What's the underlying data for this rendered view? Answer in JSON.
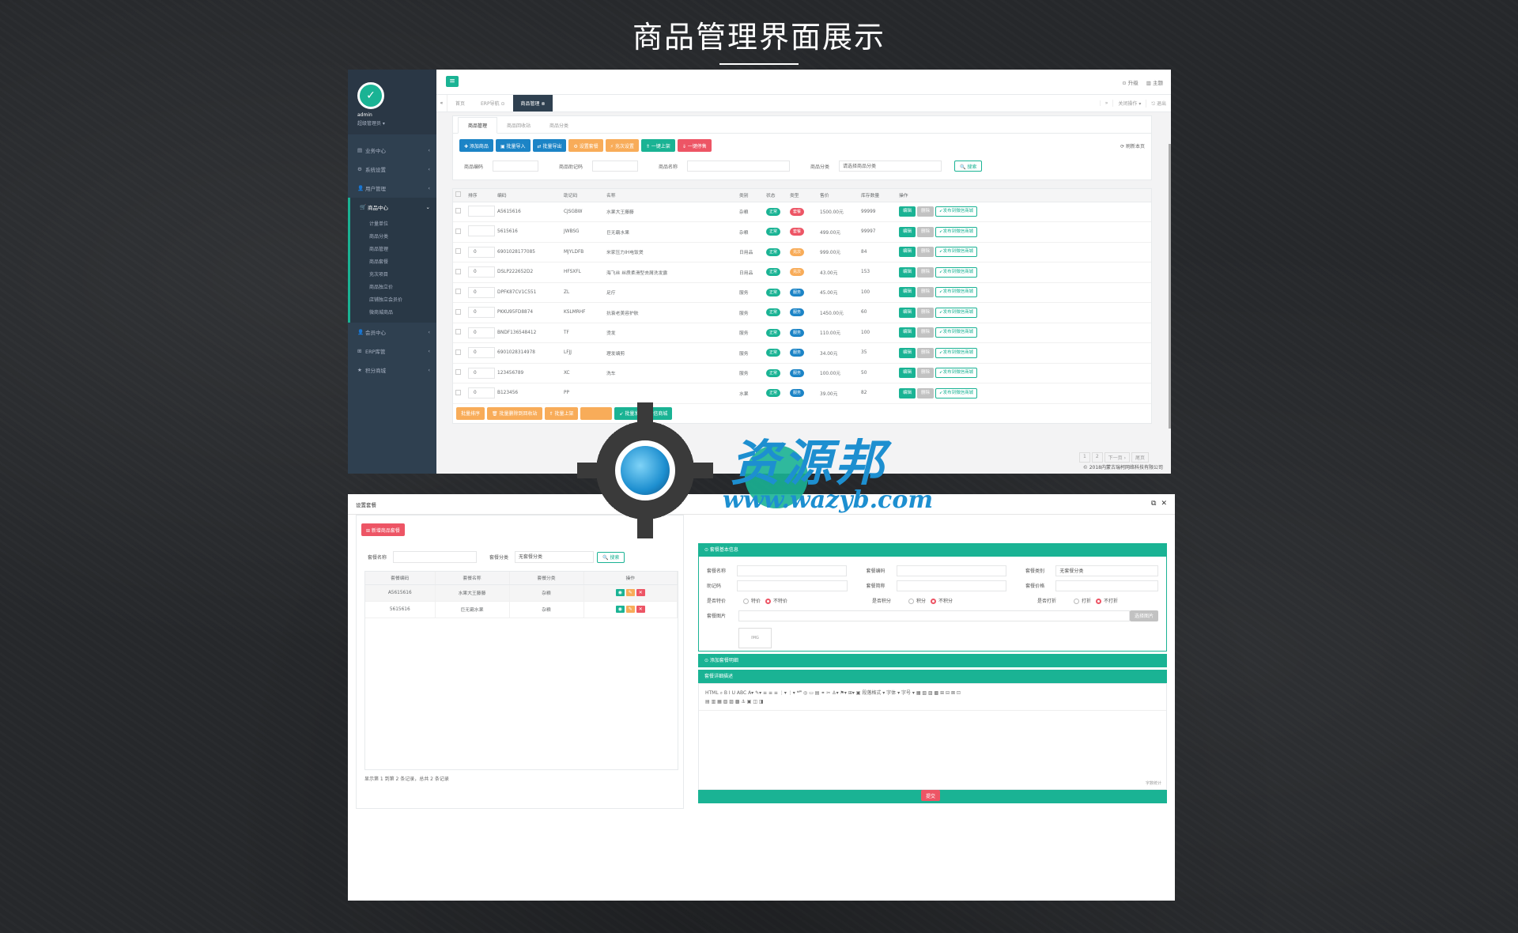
{
  "page": {
    "title": "商品管理界面展示"
  },
  "sidebar": {
    "user": "admin",
    "role": "超级管理员 ▾",
    "items": [
      {
        "icon": "chart-icon",
        "label": "业务中心"
      },
      {
        "icon": "gear-icon",
        "label": "系统设置"
      },
      {
        "icon": "user-icon",
        "label": "用户管理"
      }
    ],
    "active": "商品中心",
    "sub": [
      "计量单位",
      "商品分类",
      "商品管理",
      "商品套餐",
      "充次项目",
      "商品独立价",
      "店铺独立会员价",
      "微商城商品"
    ],
    "after": [
      {
        "icon": "user-icon",
        "label": "会员中心"
      },
      {
        "icon": "sitemap-icon",
        "label": "ERP库管"
      },
      {
        "icon": "star-icon",
        "label": "积分商城"
      }
    ]
  },
  "header": {
    "upgrade": "⊙ 升级",
    "theme": "▥ 主题"
  },
  "tabs": {
    "home": "首页",
    "erp": "ERP导航 ⊙",
    "goods": "商品管理 ⊗",
    "close_ops": "关闭操作 ▾",
    "logout": "⎋ 退出"
  },
  "panel": {
    "tabs": [
      "商品管理",
      "商品回收站",
      "商品分类"
    ],
    "buttons": [
      "✚ 添加商品",
      "▣ 批量导入",
      "⇄ 批量导出",
      "⚙ 设置套餐",
      "⚡ 充次设置",
      "⇑ 一键上架",
      "⇓ 一键停售"
    ],
    "refresh": "⟳ 刷新本页",
    "filters": {
      "code": "商品编码",
      "mnemonic": "商品助记码",
      "name": "商品名称",
      "category": "商品分类",
      "category_ph": "请选择商品分类",
      "search": "🔍 搜索"
    }
  },
  "table": {
    "headers": [
      "",
      "排序",
      "编码",
      "助记码",
      "名称",
      "类别",
      "状态",
      "类型",
      "售价",
      "库存数量",
      "操作"
    ],
    "rows": [
      {
        "sort": "",
        "code": "A5615616",
        "mn": "CJSGBW",
        "name": "水果大王藤藤",
        "cat": "杂粮",
        "status": "正常",
        "type": "套餐",
        "tc": "r",
        "price": "1500.00元",
        "stock": "99999"
      },
      {
        "sort": "",
        "code": "5615616",
        "mn": "JWBSG",
        "name": "巨无霸水果",
        "cat": "杂粮",
        "status": "正常",
        "type": "套餐",
        "tc": "r",
        "price": "499.00元",
        "stock": "99997"
      },
      {
        "sort": "0",
        "code": "6901028177085",
        "mn": "MJYLDFB",
        "name": "米家压力IH电饭煲",
        "cat": "日用品",
        "status": "正常",
        "type": "充次",
        "tc": "o",
        "price": "999.00元",
        "stock": "84"
      },
      {
        "sort": "0",
        "code": "DSLP222652D2",
        "mn": "HFSXFL",
        "name": "海飞丝 丝质柔滑型去屑洗发露",
        "cat": "日用品",
        "status": "正常",
        "type": "充次",
        "tc": "o",
        "price": "43.00元",
        "stock": "153"
      },
      {
        "sort": "0",
        "code": "DPFK87CV1C551",
        "mn": "ZL",
        "name": "足疗",
        "cat": "服务",
        "status": "正常",
        "type": "服务",
        "tc": "b",
        "price": "45.00元",
        "stock": "100"
      },
      {
        "sort": "0",
        "code": "PKKU95FD8874",
        "mn": "KSLMRHF",
        "name": "抗衰老美容护肤",
        "cat": "服务",
        "status": "正常",
        "type": "服务",
        "tc": "b",
        "price": "1450.00元",
        "stock": "60"
      },
      {
        "sort": "0",
        "code": "BNDF136548412",
        "mn": "TF",
        "name": "烫发",
        "cat": "服务",
        "status": "正常",
        "type": "服务",
        "tc": "b",
        "price": "110.00元",
        "stock": "100"
      },
      {
        "sort": "0",
        "code": "6901028314978",
        "mn": "LFJJ",
        "name": "理发编剪",
        "cat": "服务",
        "status": "正常",
        "type": "服务",
        "tc": "b",
        "price": "34.00元",
        "stock": "35"
      },
      {
        "sort": "0",
        "code": "123456789",
        "mn": "XC",
        "name": "洗车",
        "cat": "服务",
        "status": "正常",
        "type": "服务",
        "tc": "b",
        "price": "100.00元",
        "stock": "50"
      },
      {
        "sort": "0",
        "code": "B123456",
        "mn": "PP",
        "name": "",
        "cat": "水果",
        "status": "正常",
        "type": "服务",
        "tc": "b",
        "price": "39.00元",
        "stock": "82"
      }
    ],
    "edit": "编辑",
    "del": "删除",
    "publish": "➹发布到微信商城"
  },
  "bottom": {
    "buttons": [
      "批量排序",
      "🗑 批量删除到回收站",
      "⇑ 批量上架",
      "",
      "➹ 批量发布到微信商城"
    ]
  },
  "pager": [
    "1",
    "2",
    "下一页 ›",
    "尾页"
  ],
  "copyright": "© 2018内蒙古瑞柯网络科技有限公司",
  "modal": {
    "title": "设置套餐",
    "new_btn": "⊞ 新增商品套餐",
    "filter": {
      "name": "套餐名称",
      "cat": "套餐分类",
      "cat_val": "无套餐分类",
      "search": "🔍 搜索"
    },
    "headers": [
      "套餐编码",
      "套餐名称",
      "套餐分类",
      "操作"
    ],
    "rows": [
      {
        "code": "A5615616",
        "name": "水果大王藤藤",
        "cat": "杂粮"
      },
      {
        "code": "5615616",
        "name": "巨无霸水果",
        "cat": "杂粮"
      }
    ],
    "footer": "显示第 1 到第 2 条记录，总共 2 条记录",
    "basic": "⊙ 套餐基本信息",
    "form": {
      "name": "套餐名称",
      "code": "套餐编码",
      "cat": "套餐类别",
      "cat_val": "无套餐分类",
      "mn": "助记码",
      "abbr": "套餐简称",
      "price": "套餐价格",
      "special": "是否特价",
      "spec_y": "特价",
      "spec_n": "不特价",
      "points": "是否积分",
      "pts_y": "积分",
      "pts_n": "不积分",
      "discount": "是否打折",
      "dis_y": "打折",
      "dis_n": "不打折",
      "img": "套餐图片",
      "img_btn": "选择图片"
    },
    "add_detail": "⊙ 添加套餐明细",
    "desc": "套餐详细描述",
    "editor_tools": "HTML  ⌕  B  I  U  ABC  A▾  ✎▾  ≡  ≡  ≡  ⋮▾  ⋮▾  ❝❞  ◎  ▭  ▤  ⚭  ✂  ⚓▾  ⚑▾  ⊞▾  ▣  段落格式 ▾  字体 ▾  字号 ▾  ▦  ▧  ▨  ▩  ⊞  ⊟  ⊠  ⊡",
    "editor_tools2": "▤ ▥ ▦ ▧ ▨ ▩  ⚓ ▣ ◫ ◨",
    "word_count": "字数统计",
    "submit": "提交"
  },
  "watermark": {
    "text": "资源邦",
    "url": "www.wazyb.com"
  }
}
